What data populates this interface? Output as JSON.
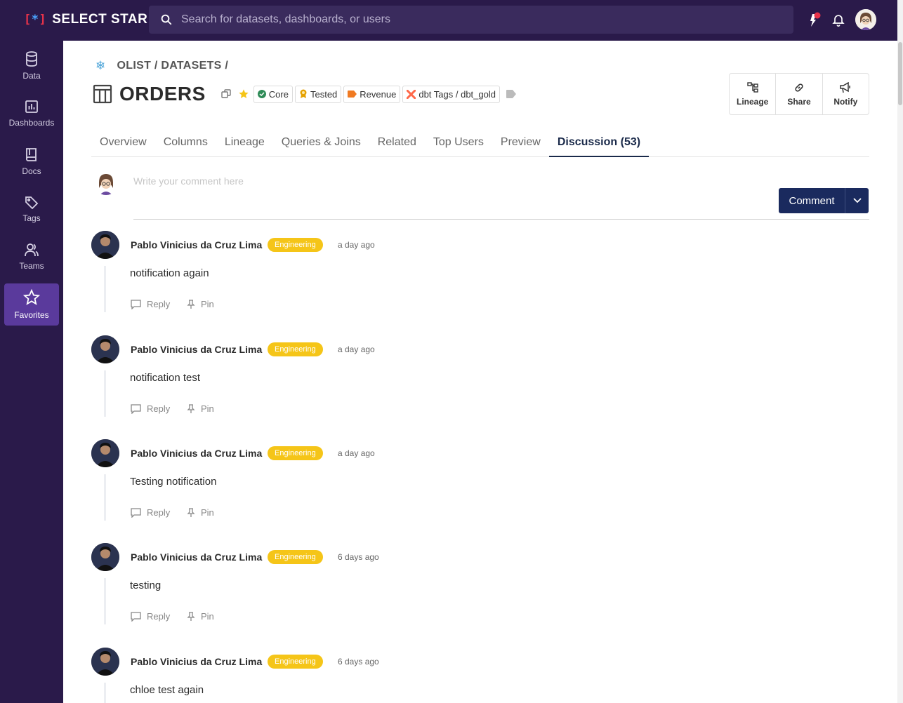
{
  "app": {
    "name": "SELECT STAR"
  },
  "search": {
    "placeholder": "Search for datasets, dashboards, or users"
  },
  "sidebar": {
    "items": [
      {
        "label": "Data",
        "icon": "database-icon"
      },
      {
        "label": "Dashboards",
        "icon": "chart-icon"
      },
      {
        "label": "Docs",
        "icon": "book-icon"
      },
      {
        "label": "Tags",
        "icon": "tag-icon"
      },
      {
        "label": "Teams",
        "icon": "users-icon"
      },
      {
        "label": "Favorites",
        "icon": "star-icon",
        "active": true
      }
    ]
  },
  "breadcrumb": {
    "text": "OLIST / DATASETS /"
  },
  "dataset": {
    "title": "ORDERS",
    "tags": [
      {
        "label": "Core",
        "icon": "check-circle-icon",
        "color": "#2e8b57"
      },
      {
        "label": "Tested",
        "icon": "medal-icon",
        "color": "#e5a100"
      },
      {
        "label": "Revenue",
        "icon": "tag-icon",
        "color": "#f07a22"
      },
      {
        "label": "dbt Tags / dbt_gold",
        "icon": "dbt-icon",
        "color": "#ff694a"
      }
    ]
  },
  "actions": {
    "lineage": "Lineage",
    "share": "Share",
    "notify": "Notify"
  },
  "tabs": [
    {
      "label": "Overview"
    },
    {
      "label": "Columns"
    },
    {
      "label": "Lineage"
    },
    {
      "label": "Queries & Joins"
    },
    {
      "label": "Related"
    },
    {
      "label": "Top Users"
    },
    {
      "label": "Preview"
    },
    {
      "label": "Discussion (53)",
      "active": true
    }
  ],
  "composer": {
    "placeholder": "Write your comment here",
    "button": "Comment"
  },
  "comment_labels": {
    "reply": "Reply",
    "pin": "Pin"
  },
  "comments": [
    {
      "author": "Pablo Vinicius da Cruz Lima",
      "team": "Engineering",
      "time": "a day ago",
      "text": "notification again"
    },
    {
      "author": "Pablo Vinicius da Cruz Lima",
      "team": "Engineering",
      "time": "a day ago",
      "text": "notification test"
    },
    {
      "author": "Pablo Vinicius da Cruz Lima",
      "team": "Engineering",
      "time": "a day ago",
      "text": "Testing notification"
    },
    {
      "author": "Pablo Vinicius da Cruz Lima",
      "team": "Engineering",
      "time": "6 days ago",
      "text": "testing"
    },
    {
      "author": "Pablo Vinicius da Cruz Lima",
      "team": "Engineering",
      "time": "6 days ago",
      "text": "chloe test again"
    }
  ],
  "colors": {
    "nav_bg": "#2a1a4a",
    "active_nav": "#5a3a9c",
    "button": "#1a2a5e",
    "badge": "#f5c518"
  }
}
